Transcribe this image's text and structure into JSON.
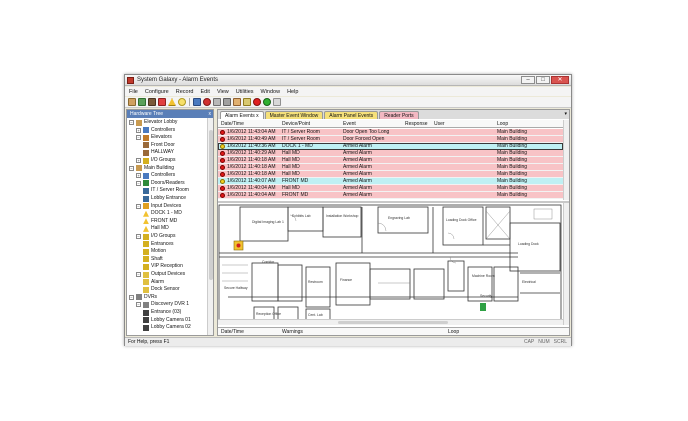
{
  "window": {
    "title": "System Galaxy - Alarm Events",
    "min": "–",
    "max": "□",
    "close": "✕"
  },
  "menu": [
    "File",
    "Configure",
    "Record",
    "Edit",
    "View",
    "Utilities",
    "Window",
    "Help"
  ],
  "toolbar_icons": [
    "cardholder-icon",
    "access-icon",
    "door-icon",
    "alarm-icon",
    "warning-icon",
    "bulb-icon",
    "status-icon",
    "record-icon",
    "keyboard-icon",
    "tools-icon",
    "people-icon",
    "search-icon",
    "stop-icon",
    "go-icon",
    "lock-icon"
  ],
  "tree": {
    "header": "Hardware Tree",
    "close": "x",
    "nodes": [
      {
        "label": "Elevator Lobby",
        "level": 1,
        "exp": "−",
        "icon": "building-icon"
      },
      {
        "label": "Controllers",
        "level": 2,
        "exp": "+",
        "icon": "controller-icon"
      },
      {
        "label": "Elevators",
        "level": 2,
        "exp": "−",
        "icon": "elevator-icon"
      },
      {
        "label": "Front Door",
        "level": 3,
        "exp": "",
        "icon": "elevator-door-icon"
      },
      {
        "label": "HALLWAY",
        "level": 3,
        "exp": "",
        "icon": "elevator-door-icon"
      },
      {
        "label": "I/O Groups",
        "level": 2,
        "exp": "+",
        "icon": "io-group-icon"
      },
      {
        "label": "Main Building",
        "level": 1,
        "exp": "−",
        "icon": "building-icon"
      },
      {
        "label": "Controllers",
        "level": 2,
        "exp": "+",
        "icon": "controller-icon"
      },
      {
        "label": "Doors/Readers",
        "level": 2,
        "exp": "−",
        "icon": "door-icon"
      },
      {
        "label": "IT / Server Room",
        "level": 3,
        "exp": "",
        "icon": "reader-icon"
      },
      {
        "label": "Lobby Entrance",
        "level": 3,
        "exp": "",
        "icon": "reader-icon"
      },
      {
        "label": "Input Devices",
        "level": 2,
        "exp": "−",
        "icon": "input-icon"
      },
      {
        "label": "DOCK 1 - MD",
        "level": 3,
        "exp": "",
        "icon": "warning-icon"
      },
      {
        "label": "FRONT MD",
        "level": 3,
        "exp": "",
        "icon": "warning-icon"
      },
      {
        "label": "Hall MD",
        "level": 3,
        "exp": "",
        "icon": "warning-icon"
      },
      {
        "label": "I/O Groups",
        "level": 2,
        "exp": "−",
        "icon": "io-group-icon"
      },
      {
        "label": "Entrances",
        "level": 3,
        "exp": "",
        "icon": "io-group-icon"
      },
      {
        "label": "Motion",
        "level": 3,
        "exp": "",
        "icon": "io-group-icon"
      },
      {
        "label": "Shaft",
        "level": 3,
        "exp": "",
        "icon": "io-group-icon"
      },
      {
        "label": "VIP Reception",
        "level": 3,
        "exp": "",
        "icon": "io-group-icon"
      },
      {
        "label": "Output Devices",
        "level": 2,
        "exp": "−",
        "icon": "output-icon"
      },
      {
        "label": "Alarm",
        "level": 3,
        "exp": "",
        "icon": "output-icon"
      },
      {
        "label": "Dock Sensor",
        "level": 3,
        "exp": "",
        "icon": "output-icon"
      },
      {
        "label": "DVRs",
        "level": 1,
        "exp": "−",
        "icon": "dvr-icon"
      },
      {
        "label": "Discovery DVR 1",
        "level": 2,
        "exp": "−",
        "icon": "dvr-icon"
      },
      {
        "label": "Entrance (03)",
        "level": 3,
        "exp": "",
        "icon": "camera-icon"
      },
      {
        "label": "Lobby Camera 01",
        "level": 3,
        "exp": "",
        "icon": "camera-icon"
      },
      {
        "label": "Lobby Camera 02",
        "level": 3,
        "exp": "",
        "icon": "camera-icon"
      }
    ]
  },
  "tabs": [
    {
      "label": "Alarm Events",
      "style": "active",
      "close": "x"
    },
    {
      "label": "Master Event Window",
      "style": "yellow",
      "close": ""
    },
    {
      "label": "Alarm Panel Events",
      "style": "yellow",
      "close": ""
    },
    {
      "label": "Reader Ports",
      "style": "pink",
      "close": ""
    }
  ],
  "tab_dropdown": "▾",
  "alarm_grid": {
    "columns": [
      "Date/Time",
      "Device/Point",
      "Event",
      "Response",
      "User",
      "Loop"
    ],
    "rows": [
      {
        "date": "1/6/2012 11:43:04 AM",
        "device": "IT / Server Room",
        "event": "Door Open Too Long",
        "response": "",
        "user": "",
        "loop": "Main Building",
        "color": "red",
        "dot": "red"
      },
      {
        "date": "1/6/2012 11:40:49 AM",
        "device": "IT / Server Room",
        "event": "Door Forced Open",
        "response": "",
        "user": "",
        "loop": "Main Building",
        "color": "red",
        "dot": "red"
      },
      {
        "date": "1/6/2012 11:40:36 AM",
        "device": "DOCK 1 - MD",
        "event": "Armed Alarm",
        "response": "",
        "user": "",
        "loop": "Main Building",
        "color": "cyan",
        "dot": "yellow",
        "selected": true
      },
      {
        "date": "1/6/2012 11:40:29 AM",
        "device": "Hall MD",
        "event": "Armed Alarm",
        "response": "",
        "user": "",
        "loop": "Main Building",
        "color": "red",
        "dot": "red"
      },
      {
        "date": "1/6/2012 11:40:18 AM",
        "device": "Hall MD",
        "event": "Armed Alarm",
        "response": "",
        "user": "",
        "loop": "Main Building",
        "color": "red",
        "dot": "red"
      },
      {
        "date": "1/6/2012 11:40:18 AM",
        "device": "Hall MD",
        "event": "Armed Alarm",
        "response": "",
        "user": "",
        "loop": "Main Building",
        "color": "red",
        "dot": "red"
      },
      {
        "date": "1/6/2012 11:40:18 AM",
        "device": "Hall MD",
        "event": "Armed Alarm",
        "response": "",
        "user": "",
        "loop": "Main Building",
        "color": "red",
        "dot": "red"
      },
      {
        "date": "1/6/2012 11:40:07 AM",
        "device": "FRONT MD",
        "event": "Armed Alarm",
        "response": "",
        "user": "",
        "loop": "Main Building",
        "color": "cyan",
        "dot": "yellow"
      },
      {
        "date": "1/6/2012 11:40:04 AM",
        "device": "Hall MD",
        "event": "Armed Alarm",
        "response": "",
        "user": "",
        "loop": "Main Building",
        "color": "red",
        "dot": "red"
      },
      {
        "date": "1/6/2012 11:40:04 AM",
        "device": "FRONT MD",
        "event": "Armed Alarm",
        "response": "",
        "user": "",
        "loop": "Main Building",
        "color": "red",
        "dot": "red"
      }
    ]
  },
  "floorplan": {
    "rooms": [
      "Digital Imaging Lab 1",
      "Exhibits Lab",
      "Installation Workshop",
      "Engraving Lab",
      "Loading Dock Office",
      "Loading Dock",
      "Corridor",
      "Restroom",
      "Secure Hallway",
      "Finance",
      "Reception Office",
      "Cent. Lab",
      "Security",
      "Machine Room",
      "Electrical"
    ],
    "alarm_device": "warning-icon"
  },
  "warnings_grid": {
    "columns": [
      "Date/Time",
      "Warnings",
      "Loop"
    ]
  },
  "status": {
    "help": "For Help, press F1",
    "keys": [
      "CAP",
      "NUM",
      "SCRL"
    ]
  },
  "colors": {
    "alarm_red": "#f8c3c6",
    "alarm_cyan": "#bff0f3",
    "tab_yellow": "#f5e07a",
    "tab_pink": "#f3b8c2",
    "tree_header": "#5a7fb8"
  }
}
